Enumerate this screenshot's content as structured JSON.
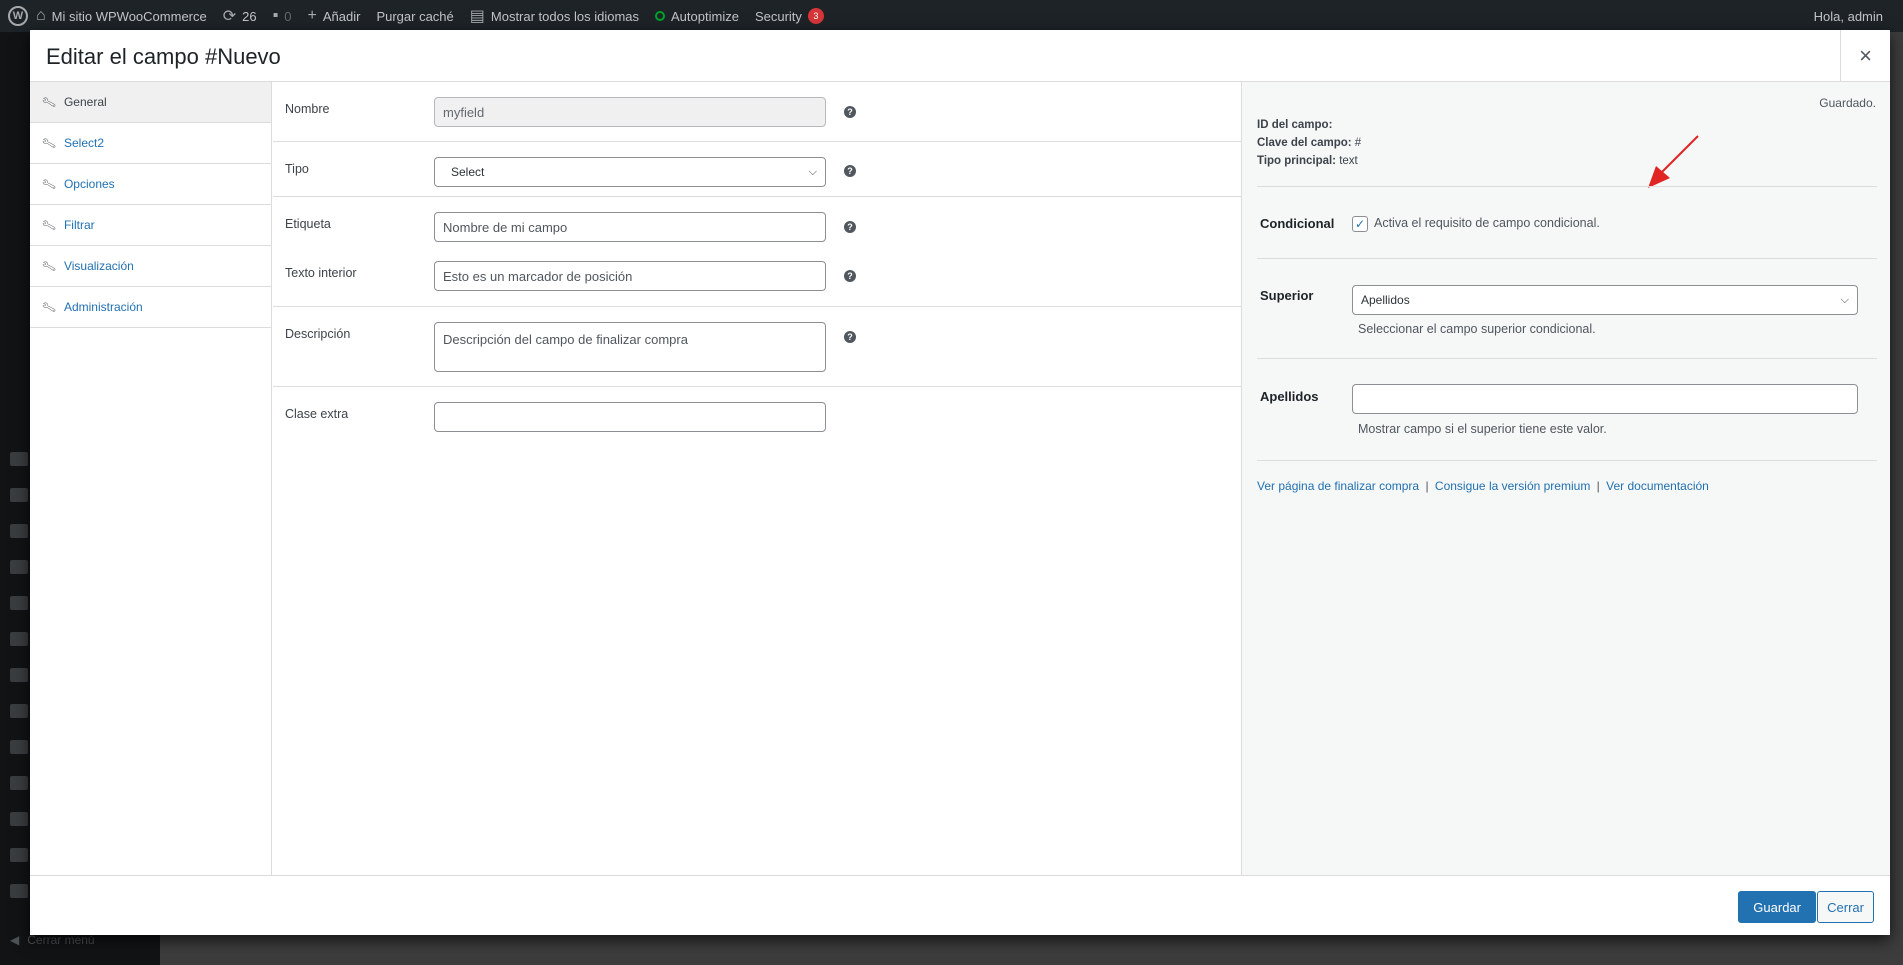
{
  "adminbar": {
    "site_name": "Mi sitio WPWooCommerce",
    "updates_count": "26",
    "comments_count": "0",
    "add_new": "Añadir",
    "purge_cache": "Purgar caché",
    "languages": "Mostrar todos los idiomas",
    "autoptimize": "Autoptimize",
    "security": "Security",
    "security_count": "3",
    "greeting": "Hola, admin"
  },
  "adminmenu": {
    "collapse_label": "Cerrar menú"
  },
  "modal": {
    "title": "Editar el campo #Nuevo",
    "close_glyph": "×"
  },
  "tabs": [
    {
      "label": "General"
    },
    {
      "label": "Select2"
    },
    {
      "label": "Opciones"
    },
    {
      "label": "Filtrar"
    },
    {
      "label": "Visualización"
    },
    {
      "label": "Administración"
    }
  ],
  "form": {
    "nombre": {
      "label": "Nombre",
      "value": "myfield"
    },
    "tipo": {
      "label": "Tipo",
      "value": "Select"
    },
    "etiqueta": {
      "label": "Etiqueta",
      "placeholder": "Nombre de mi campo"
    },
    "texto_interior": {
      "label": "Texto interior",
      "placeholder": "Esto es un marcador de posición"
    },
    "descripcion": {
      "label": "Descripción",
      "placeholder": "Descripción del campo de finalizar compra"
    },
    "clase_extra": {
      "label": "Clase extra",
      "value": ""
    },
    "help_glyph": "?"
  },
  "panel": {
    "saved": "Guardado.",
    "id_label": "ID del campo:",
    "key_label": "Clave del campo:",
    "key_value": "#",
    "type_label": "Tipo principal:",
    "type_value": "text",
    "conditional_label": "Condicional",
    "conditional_text": "Activa el requisito de campo condicional.",
    "conditional_checked": true,
    "parent_label": "Superior",
    "parent_value": "Apellidos",
    "parent_desc": "Seleccionar el campo superior condicional.",
    "value_label": "Apellidos",
    "value_value": "",
    "value_desc": "Mostrar campo si el superior tiene este valor.",
    "link_checkout": "Ver página de finalizar compra",
    "link_premium": "Consigue la versión premium",
    "link_docs": "Ver documentación",
    "link_separator": "|",
    "arrow_color": "#e02424"
  },
  "footer": {
    "save": "Guardar",
    "close": "Cerrar"
  }
}
